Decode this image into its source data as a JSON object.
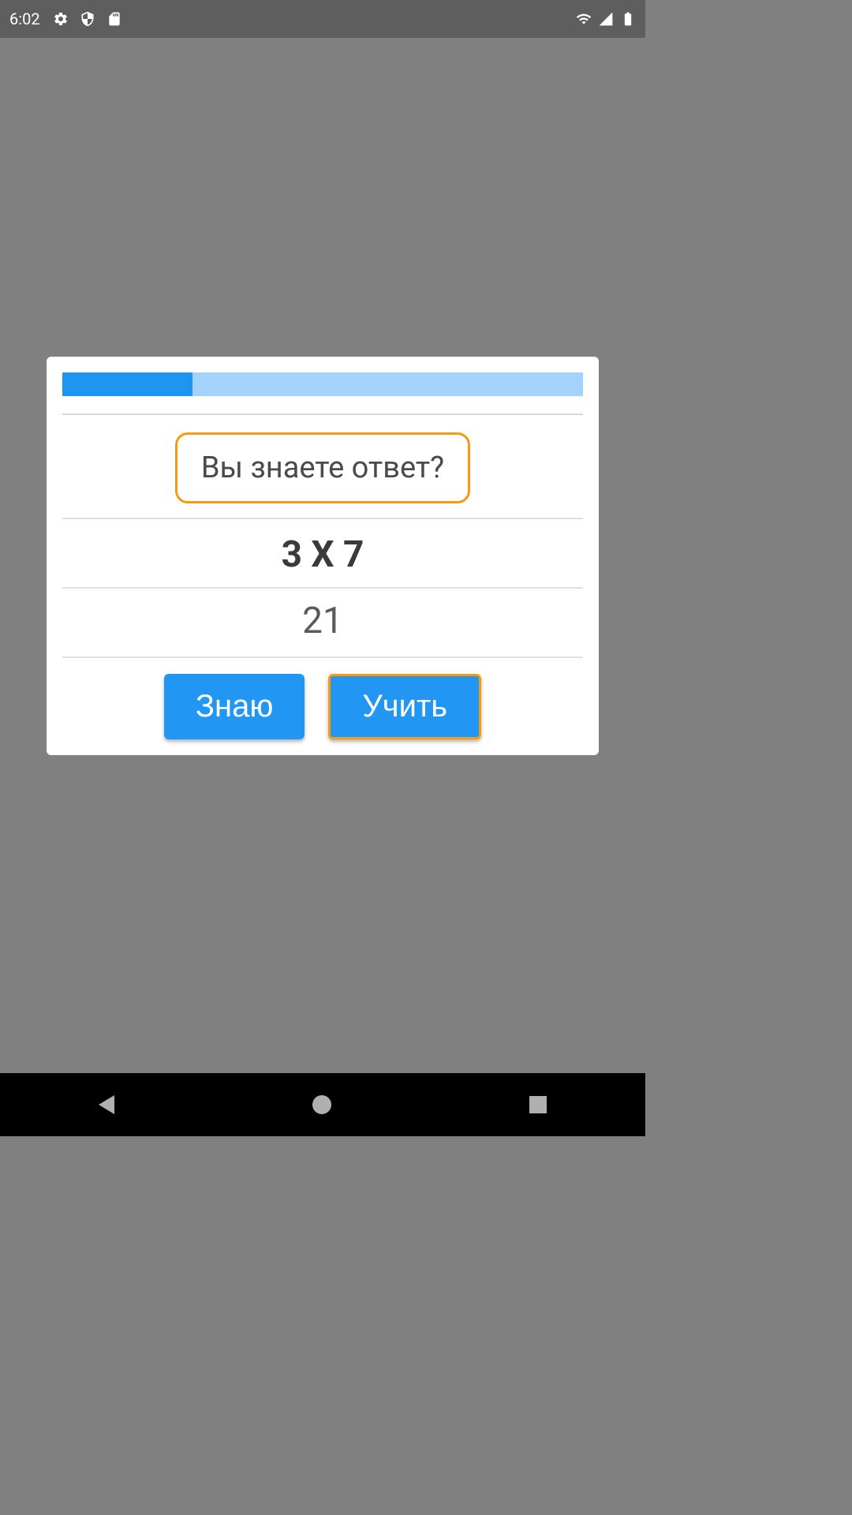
{
  "statusBar": {
    "time": "6:02"
  },
  "dialog": {
    "progressPercent": 25,
    "questionPrompt": "Вы знаете ответ?",
    "equation": "3 X 7",
    "answer": "21",
    "knowButton": "Знаю",
    "learnButton": "Учить"
  }
}
